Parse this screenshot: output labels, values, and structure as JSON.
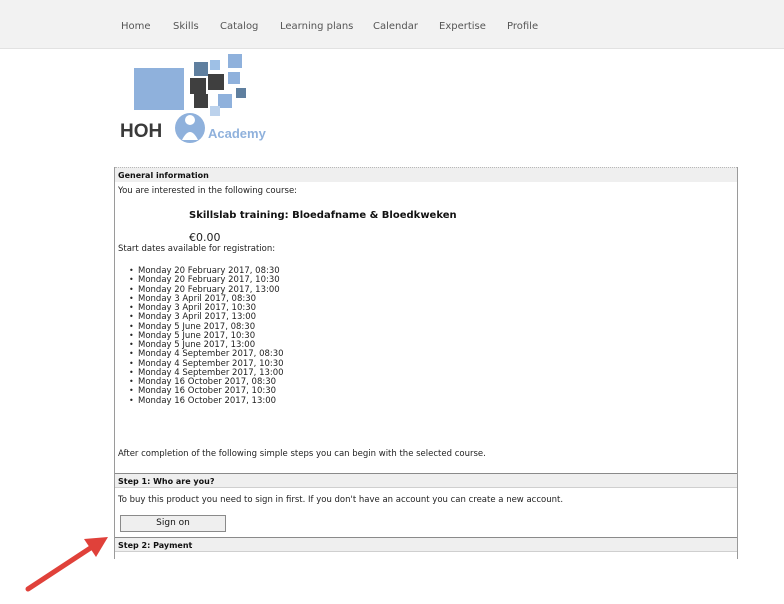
{
  "nav": {
    "items": [
      {
        "label": "Home"
      },
      {
        "label": "Skills"
      },
      {
        "label": "Catalog"
      },
      {
        "label": "Learning plans"
      },
      {
        "label": "Calendar"
      },
      {
        "label": "Expertise"
      },
      {
        "label": "Profile"
      }
    ]
  },
  "logo": {
    "brand": "HOH",
    "wordmark": "Academy"
  },
  "general": {
    "header": "General information",
    "intro": "You are interested in the following course:",
    "course_title": "Skillslab training: Bloedafname & Bloedkweken",
    "price": "€0.00",
    "dates_label": "Start dates available for registration:",
    "dates": [
      "Monday 20 February 2017, 08:30",
      "Monday 20 February 2017, 10:30",
      "Monday 20 February 2017, 13:00",
      "Monday 3 April 2017, 08:30",
      "Monday 3 April 2017, 10:30",
      "Monday 3 April 2017, 13:00",
      "Monday 5 June 2017, 08:30",
      "Monday 5 June 2017, 10:30",
      "Monday 5 June 2017, 13:00",
      "Monday 4 September 2017, 08:30",
      "Monday 4 September 2017, 10:30",
      "Monday 4 September 2017, 13:00",
      "Monday 16 October 2017, 08:30",
      "Monday 16 October 2017, 10:30",
      "Monday 16 October 2017, 13:00"
    ],
    "completion_note": "After completion of the following simple steps you can begin with the selected course."
  },
  "step1": {
    "header": "Step 1: Who are you?",
    "text": "To buy this product you need to sign in first. If you don't have an account you can create a new account.",
    "button_label": "Sign on"
  },
  "step2": {
    "header": "Step 2: Payment"
  },
  "colors": {
    "arrow": "#e0413a",
    "logo_blue": "#8fb1dc",
    "logo_dark": "#3a3a3a"
  }
}
